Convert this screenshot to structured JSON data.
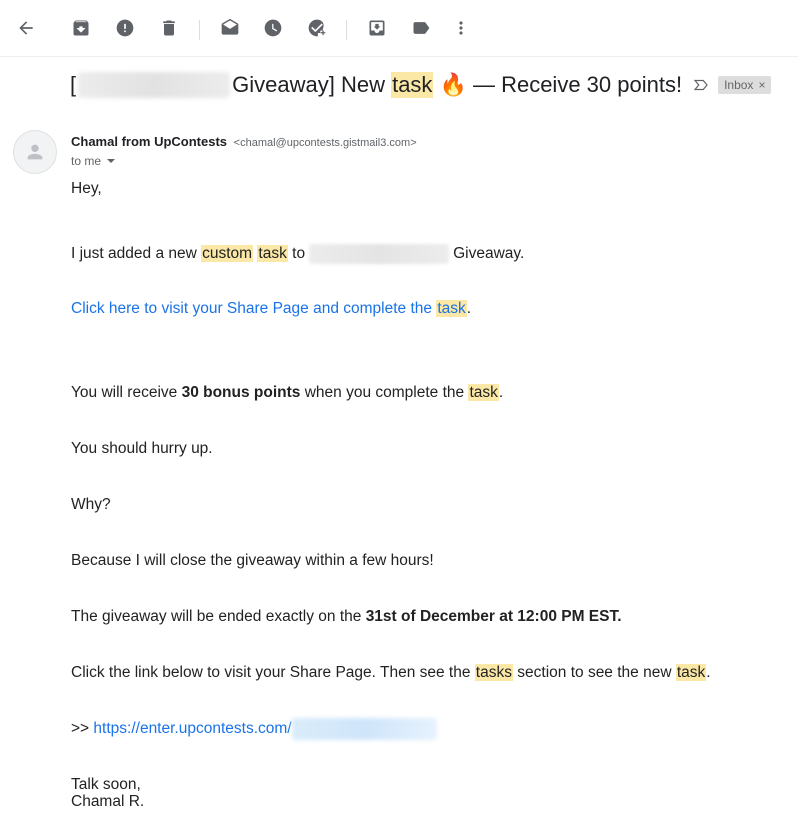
{
  "toolbar": {
    "icons": [
      "back-arrow-icon",
      "archive-icon",
      "report-spam-icon",
      "delete-icon",
      "mark-unread-icon",
      "snooze-icon",
      "add-task-icon",
      "move-to-icon",
      "label-icon",
      "more-vert-icon"
    ]
  },
  "subject": {
    "prefix": "[",
    "giveaway": "Giveaway] New ",
    "highlight": "task",
    "emoji": "🔥",
    "suffix": " — Receive 30 points!",
    "inbox_label": "Inbox",
    "inbox_close": "×"
  },
  "sender": {
    "name": "Chamal from UpContests",
    "email": "<chamal@upcontests.gistmail3.com>",
    "to": "to me"
  },
  "body": {
    "greeting": "Hey,",
    "line1_a": "I just added a new ",
    "line1_hl1": "custom",
    "line1_sp": " ",
    "line1_hl2": "task",
    "line1_b": " to",
    "line1_c": "Giveaway.",
    "link1_a": "Click here to visit your Share Page and complete the ",
    "link1_hl": "task",
    "link1_end": ".",
    "line2_a": "You will receive ",
    "line2_bold": "30 bonus points",
    "line2_b": " when you complete the ",
    "line2_hl": "task",
    "line2_end": ".",
    "line3": "You should hurry up.",
    "line4": "Why?",
    "line5": "Because I will close the giveaway within a few hours!",
    "line6_a": "The giveaway will be ended exactly on the ",
    "line6_bold": "31st of December at 12:00 PM EST.",
    "line7_a": "Click the link below to visit your Share Page. Then see the ",
    "line7_hl1": "tasks",
    "line7_b": " section to see the new ",
    "line7_hl2": "task",
    "line7_end": ".",
    "arrows": ">> ",
    "url": "https://enter.upcontests.com/",
    "signoff": "Talk soon,",
    "signature": "Chamal R."
  }
}
